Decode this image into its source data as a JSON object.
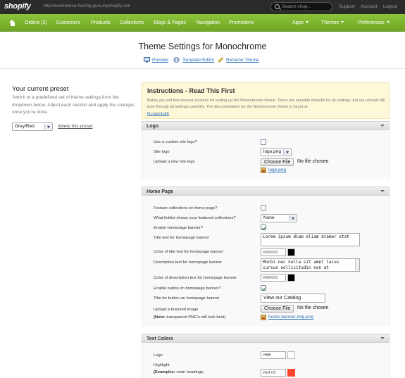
{
  "topbar": {
    "logo": "shopify",
    "shop_url": "http://ecommerce-hosting-guru.myshopify.com",
    "search_placeholder": "Search shop...",
    "links": [
      "Support",
      "Account",
      "Logout"
    ]
  },
  "nav": {
    "home_icon": "home-icon",
    "items": [
      "Orders (2)",
      "Customers",
      "Products",
      "Collections",
      "Blogs & Pages",
      "Navigation",
      "Promotions"
    ],
    "right_items": [
      "Apps",
      "Themes",
      "Preferences"
    ]
  },
  "page": {
    "title": "Theme Settings for Monochrome",
    "toolbar": [
      "Preview",
      "Template Editor",
      "Rename Theme"
    ]
  },
  "preset": {
    "title": "Your current preset",
    "description": "Switch to a predefined set of theme settings from the dropdown below. Adjust each section and apply the changes once you're done.",
    "selected": "Grey/Red",
    "delete_label": "delete this preset"
  },
  "instructions": {
    "title": "Instructions - Read This First",
    "text": "Below you will find several sections for setting up the Monochrome theme. There are sensible defaults for all settings, but you should still look through all settings carefully. The documentation for the Monochrome theme is found at",
    "link": "ht.mp/oJukK"
  },
  "logo_section": {
    "title": "Logo",
    "use_custom_label": "Use a custom site logo?",
    "use_custom_checked": false,
    "site_logo_label": "Site logo",
    "site_logo_value": "logo.png",
    "upload_label": "Upload a new site logo",
    "choose_file": "Choose File",
    "no_file": "No file chosen",
    "file_link": "logo.png"
  },
  "home_section": {
    "title": "Home Page",
    "feature_label": "Feature collections on home page?",
    "feature_checked": false,
    "linklist_label": "What linklist shows your featured collections?",
    "linklist_value": "None",
    "banner_label": "Enable homepage banner?",
    "banner_checked": true,
    "banner_title_label": "Title text for homepage banner",
    "banner_title_value": "Lorem ipsum diam eliam diamer etat",
    "title_color_label": "Color of title text for homepage banner",
    "title_color_value": "#000000",
    "desc_label": "Description text for homepage banner",
    "desc_value": "Morbi nec nulla sit amet lacus cursus sollicitudin non at",
    "desc_color_label": "Color of description text for homepage banner",
    "desc_color_value": "#000000",
    "button_label": "Enable button on homepage banner?",
    "button_checked": true,
    "button_title_label": "Title for button on homepage banner",
    "button_title_value": "View our Catalog",
    "upload_label": "Upload a featured image",
    "note_bold": "(Note:",
    "note_rest": " transparent PNG's will look best)",
    "choose_file": "Choose File",
    "no_file": "No file chosen",
    "file_link": "home-banner-img.png"
  },
  "text_colors": {
    "title": "Text Colors",
    "logo_label": "Logo",
    "logo_value": "#ffffff",
    "highlight_label": "Highlight",
    "examples_bold": "(Examples:",
    "examples_rest": " main headings,",
    "highlight_value": "#fe472f"
  },
  "colors": {
    "accent_green": "#7cb82f",
    "swatch_black": "#000000",
    "swatch_white": "#ffffff",
    "swatch_red": "#fe472f"
  }
}
